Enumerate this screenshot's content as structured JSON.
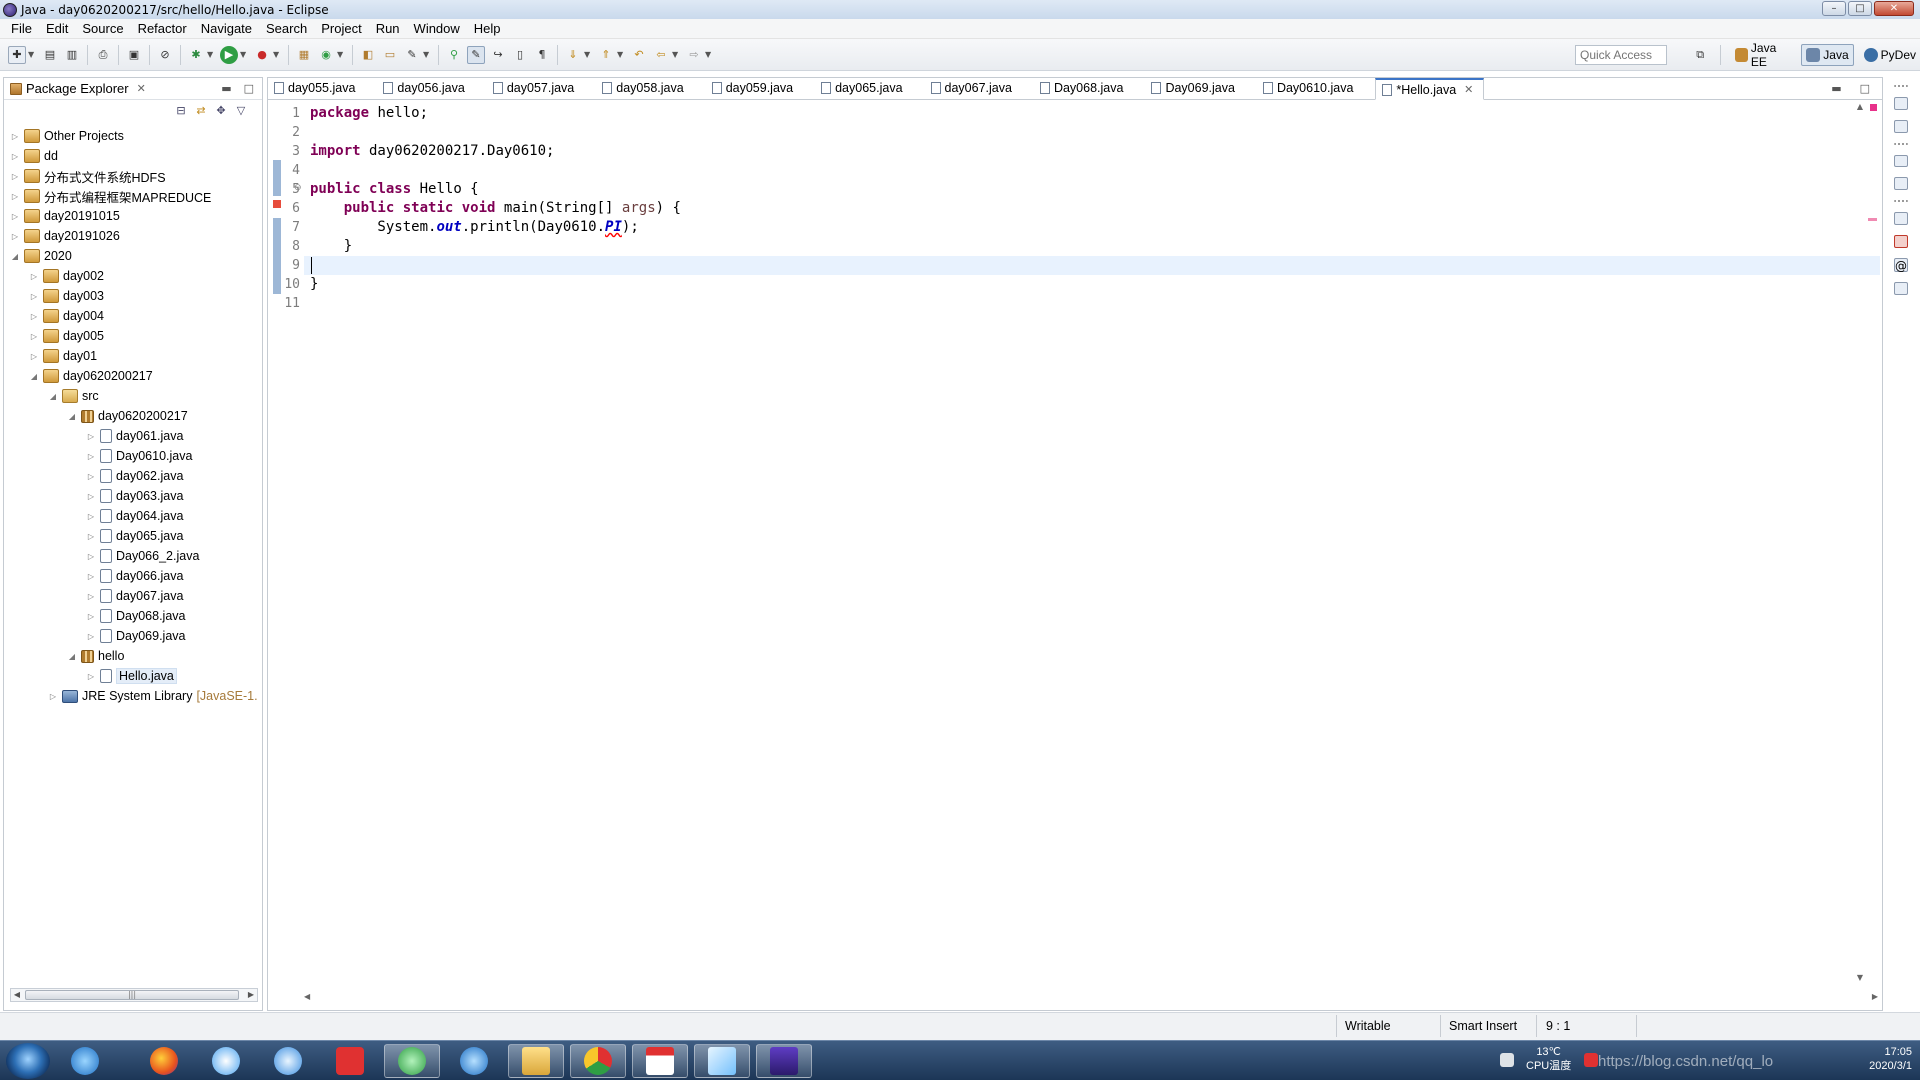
{
  "window": {
    "title": "Java - day0620200217/src/hello/Hello.java - Eclipse"
  },
  "menu": [
    "File",
    "Edit",
    "Source",
    "Refactor",
    "Navigate",
    "Search",
    "Project",
    "Run",
    "Window",
    "Help"
  ],
  "toolbar": {
    "quick_access_placeholder": "Quick Access",
    "perspectives": [
      {
        "label": "Java EE",
        "active": false
      },
      {
        "label": "Java",
        "active": true
      },
      {
        "label": "PyDev",
        "active": false
      }
    ]
  },
  "explorer": {
    "title": "Package Explorer",
    "tree": [
      {
        "label": "Other Projects",
        "depth": 0,
        "icon": "project",
        "expanded": false
      },
      {
        "label": "dd",
        "depth": 0,
        "icon": "project",
        "expanded": false
      },
      {
        "label": "分布式文件系统HDFS",
        "depth": 0,
        "icon": "project",
        "expanded": false
      },
      {
        "label": "分布式编程框架MAPREDUCE",
        "depth": 0,
        "icon": "project",
        "expanded": false
      },
      {
        "label": "day20191015",
        "depth": 0,
        "icon": "project",
        "expanded": false
      },
      {
        "label": "day20191026",
        "depth": 0,
        "icon": "project",
        "expanded": false
      },
      {
        "label": "2020",
        "depth": 0,
        "icon": "project",
        "expanded": true
      },
      {
        "label": "day002",
        "depth": 1,
        "icon": "project",
        "expanded": false
      },
      {
        "label": "day003",
        "depth": 1,
        "icon": "project",
        "expanded": false
      },
      {
        "label": "day004",
        "depth": 1,
        "icon": "project",
        "expanded": false
      },
      {
        "label": "day005",
        "depth": 1,
        "icon": "project",
        "expanded": false
      },
      {
        "label": "day01",
        "depth": 1,
        "icon": "project",
        "expanded": false
      },
      {
        "label": "day0620200217",
        "depth": 1,
        "icon": "project",
        "expanded": true
      },
      {
        "label": "src",
        "depth": 2,
        "icon": "folder",
        "expanded": true
      },
      {
        "label": "day0620200217",
        "depth": 3,
        "icon": "package",
        "expanded": true
      },
      {
        "label": "day061.java",
        "depth": 4,
        "icon": "java",
        "expanded": false
      },
      {
        "label": "Day0610.java",
        "depth": 4,
        "icon": "java",
        "expanded": false
      },
      {
        "label": "day062.java",
        "depth": 4,
        "icon": "java",
        "expanded": false
      },
      {
        "label": "day063.java",
        "depth": 4,
        "icon": "java",
        "expanded": false
      },
      {
        "label": "day064.java",
        "depth": 4,
        "icon": "java",
        "expanded": false
      },
      {
        "label": "day065.java",
        "depth": 4,
        "icon": "java",
        "expanded": false
      },
      {
        "label": "Day066_2.java",
        "depth": 4,
        "icon": "java",
        "expanded": false
      },
      {
        "label": "day066.java",
        "depth": 4,
        "icon": "java",
        "expanded": false
      },
      {
        "label": "day067.java",
        "depth": 4,
        "icon": "java",
        "expanded": false
      },
      {
        "label": "Day068.java",
        "depth": 4,
        "icon": "java",
        "expanded": false
      },
      {
        "label": "Day069.java",
        "depth": 4,
        "icon": "java",
        "expanded": false
      },
      {
        "label": "hello",
        "depth": 3,
        "icon": "package",
        "expanded": true
      },
      {
        "label": "Hello.java",
        "depth": 4,
        "icon": "java",
        "expanded": false,
        "selected": true
      },
      {
        "label": "JRE System Library",
        "extra": "[JavaSE-1.",
        "depth": 2,
        "icon": "jre",
        "expanded": false
      }
    ]
  },
  "editor": {
    "tabs": [
      {
        "label": "day055.java",
        "active": false
      },
      {
        "label": "day056.java",
        "active": false
      },
      {
        "label": "day057.java",
        "active": false
      },
      {
        "label": "day058.java",
        "active": false
      },
      {
        "label": "day059.java",
        "active": false
      },
      {
        "label": "day065.java",
        "active": false
      },
      {
        "label": "day067.java",
        "active": false
      },
      {
        "label": "Day068.java",
        "active": false
      },
      {
        "label": "Day069.java",
        "active": false
      },
      {
        "label": "Day0610.java",
        "active": false
      },
      {
        "label": "*Hello.java",
        "active": true
      }
    ],
    "line_numbers": [
      "1",
      "2",
      "3",
      "4",
      "5",
      "6",
      "7",
      "8",
      "9",
      "10",
      "11"
    ],
    "code": [
      [
        {
          "t": "package",
          "c": "kw"
        },
        {
          "t": " hello;"
        }
      ],
      [],
      [
        {
          "t": "import",
          "c": "kw"
        },
        {
          "t": " day0620200217.Day0610;"
        }
      ],
      [],
      [
        {
          "t": "public",
          "c": "kw"
        },
        {
          "t": " "
        },
        {
          "t": "class",
          "c": "kw"
        },
        {
          "t": " Hello {"
        }
      ],
      [
        {
          "t": "    "
        },
        {
          "t": "public",
          "c": "kw"
        },
        {
          "t": " "
        },
        {
          "t": "static",
          "c": "kw"
        },
        {
          "t": " "
        },
        {
          "t": "void",
          "c": "kw"
        },
        {
          "t": " main(String[] "
        },
        {
          "t": "args",
          "c": "param"
        },
        {
          "t": ") {"
        }
      ],
      [
        {
          "t": "        System."
        },
        {
          "t": "out",
          "c": "fld"
        },
        {
          "t": ".println(Day0610."
        },
        {
          "t": "PI",
          "c": "fld err"
        },
        {
          "t": ");"
        }
      ],
      [
        {
          "t": "    }"
        }
      ],
      [],
      [
        {
          "t": "}"
        }
      ],
      []
    ]
  },
  "status": {
    "writable": "Writable",
    "insert_mode": "Smart Insert",
    "position": "9 : 1"
  },
  "taskbar": {
    "temperature": "13℃",
    "cpu_label": "CPU温度",
    "watermark": "https://blog.csdn.net/qq_lo",
    "time": "17:05",
    "date": "2020/3/1"
  }
}
